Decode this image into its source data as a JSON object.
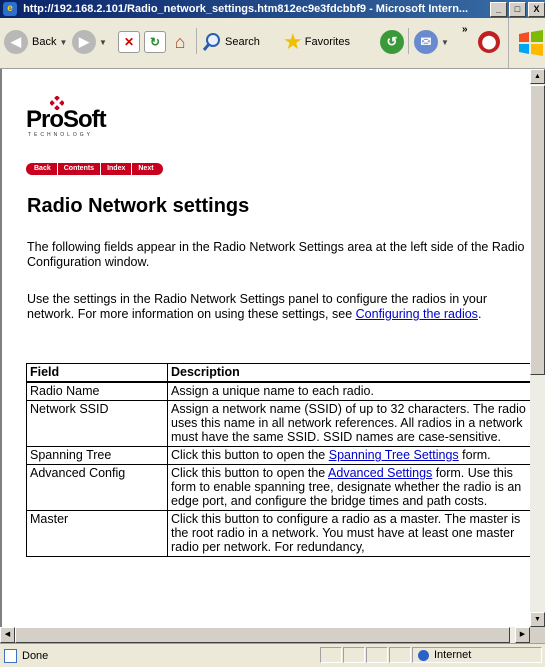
{
  "window": {
    "title": "http://192.168.2.101/Radio_network_settings.htm812ec9e3fdcbbf9 - Microsoft Intern...",
    "min_label": "_",
    "max_label": "□",
    "close_label": "X"
  },
  "toolbar": {
    "back_label": "Back",
    "search_label": "Search",
    "favorites_label": "Favorites",
    "chevron": "»"
  },
  "page": {
    "logo_text": "ProSoft",
    "logo_sub": "TECHNOLOGY",
    "nav": {
      "back": "Back",
      "contents": "Contents",
      "index": "Index",
      "next": "Next"
    },
    "heading": "Radio Network settings",
    "para1": "The following fields appear in the Radio Network Settings area at the left side of the Radio Configuration window.",
    "para2_before": "Use the settings in the Radio Network Settings panel to configure the radios in your network. For more information on using these settings, see ",
    "para2_link": "Configuring the radios",
    "para2_after": ".",
    "table": {
      "headers": [
        "Field",
        "Description"
      ],
      "rows": [
        {
          "field": "Radio Name",
          "desc": "Assign a unique name to each radio."
        },
        {
          "field": "Network SSID",
          "desc": "Assign a network name (SSID) of up to 32 characters. The radio uses this name in all network references. All radios in a network must have the same SSID. SSID names are case-sensitive."
        },
        {
          "field": "Spanning Tree",
          "desc_before": "Click this button to open the ",
          "desc_link": "Spanning Tree Settings",
          "desc_after": " form."
        },
        {
          "field": "Advanced Config",
          "desc_before": "Click this button to open the ",
          "desc_link": "Advanced Settings",
          "desc_after": " form. Use this form to enable spanning tree, designate whether the radio is an edge port, and configure the bridge times and path costs."
        },
        {
          "field": "Master",
          "desc": "Click this button to configure a radio as a master. The master is the root radio in a network. You must have at least one master radio per network. For redundancy,"
        }
      ]
    }
  },
  "status": {
    "left_text": "Done",
    "zone_text": "Internet"
  },
  "colors": {
    "nav_red": "#c8001e",
    "link": "#0000cc",
    "titlebar": "#0a246a"
  }
}
